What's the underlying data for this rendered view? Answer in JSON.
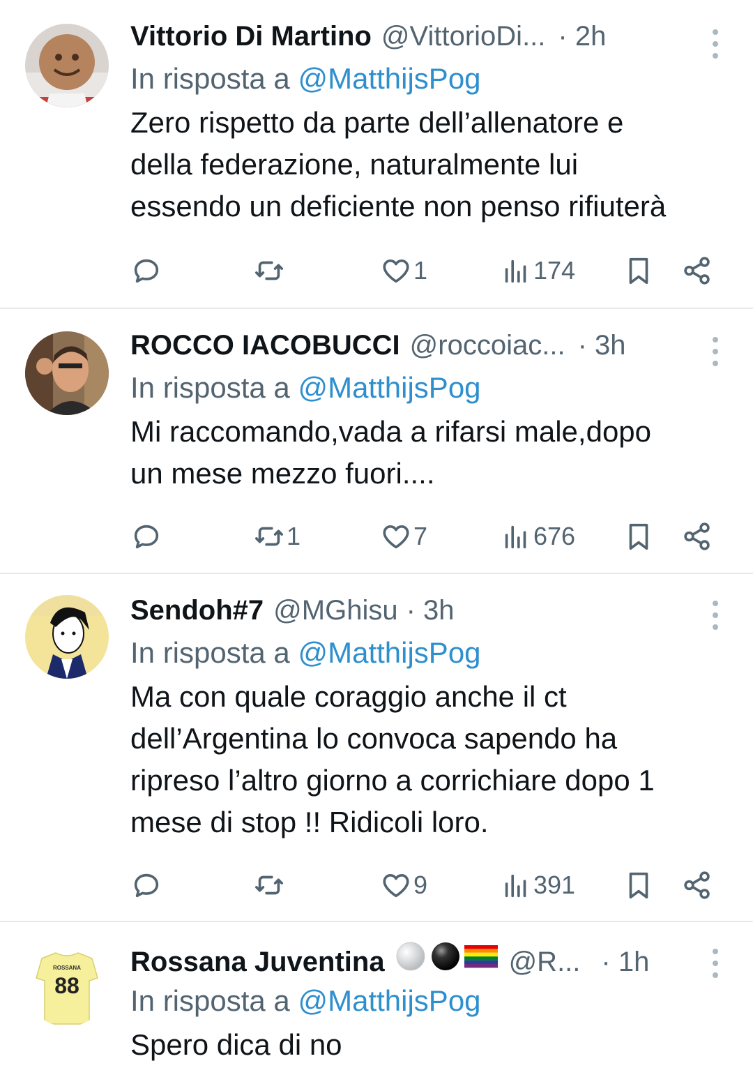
{
  "tweets": [
    {
      "name": "Vittorio Di Martino",
      "handle": "@VittorioDi...",
      "time": "· 2h",
      "reply_prefix": "In risposta a ",
      "reply_to": "@MatthijsPog",
      "lines": [
        "Zero rispetto da parte dell’allenatore e",
        "della federazione, naturalmente lui",
        "essendo un deficiente non penso rifiuterà"
      ],
      "replies": "",
      "retweets": "",
      "likes": "1",
      "views": "174"
    },
    {
      "name": "ROCCO IACOBUCCI",
      "handle": "@roccoiac...",
      "time": "· 3h",
      "reply_prefix": "In risposta a ",
      "reply_to": "@MatthijsPog",
      "lines": [
        "Mi raccomando,vada a rifarsi male,dopo",
        "un mese mezzo fuori...."
      ],
      "replies": "",
      "retweets": "1",
      "likes": "7",
      "views": "676"
    },
    {
      "name": "Sendoh#7",
      "handle": "@MGhisu",
      "time": "· 3h",
      "reply_prefix": "In risposta a ",
      "reply_to": "@MatthijsPog",
      "lines": [
        "Ma con quale coraggio anche il ct",
        "dell’Argentina lo convoca sapendo ha",
        "ripreso l’altro giorno a corrichiare dopo 1",
        "mese di stop !! Ridicoli loro."
      ],
      "replies": "",
      "retweets": "",
      "likes": "9",
      "views": "391"
    },
    {
      "name": "Rossana Juventina",
      "handle": "@R...",
      "time": "· 1h",
      "reply_prefix": "In risposta a ",
      "reply_to": "@MatthijsPog",
      "lines": [
        "Spero dica di no"
      ],
      "jersey_name": "ROSSANA",
      "jersey_number": "88"
    }
  ],
  "colors": {
    "text": "#0f1419",
    "secondary": "#536471",
    "link": "#2e8fce",
    "divider": "#e6e9ec"
  }
}
